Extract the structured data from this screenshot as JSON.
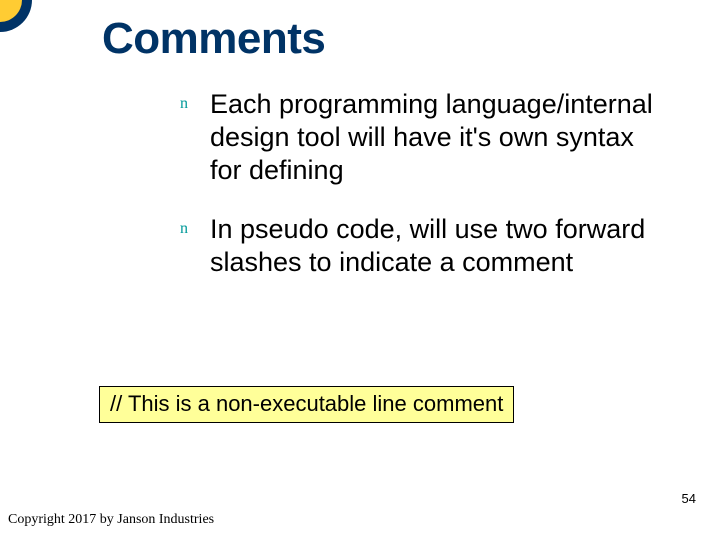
{
  "slide": {
    "title": "Comments",
    "bullets": [
      "Each programming language/internal design tool will have it's own syntax for defining",
      "In pseudo code, will use two forward slashes to indicate a comment"
    ],
    "bullet_marker": "n",
    "code_example": "// This is a non-executable line comment",
    "page_number": "54",
    "copyright": "Copyright 2017 by Janson Industries"
  }
}
